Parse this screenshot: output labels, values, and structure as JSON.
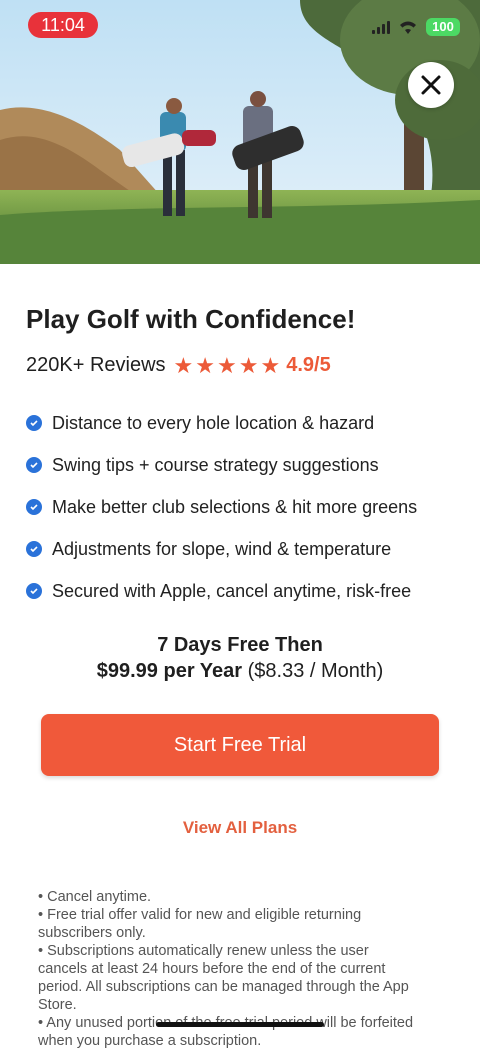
{
  "status_bar": {
    "time": "11:04",
    "battery": "100"
  },
  "headline": "Play Golf with Confidence!",
  "reviews": {
    "count": "220K+ Reviews",
    "rating": "4.9/5",
    "stars": 5
  },
  "features": [
    "Distance to every hole location & hazard",
    "Swing tips + course strategy suggestions",
    "Make better club selections & hit more greens",
    "Adjustments for slope, wind & temperature",
    "Secured with Apple, cancel anytime, risk-free"
  ],
  "pricing": {
    "line1": "7 Days Free Then",
    "price": "$99.99 per Year",
    "monthly": "($8.33 / Month)"
  },
  "cta_label": "Start Free Trial",
  "view_plans_label": "View All Plans",
  "terms": [
    "• Cancel anytime.",
    "• Free trial offer valid for new and eligible returning subscribers only.",
    "• Subscriptions automatically renew unless the user cancels at least 24 hours before the end of the current period. All subscriptions can be managed through the App Store.",
    "• Any unused portion of the free trial period will be forfeited when you purchase a subscription."
  ],
  "colors": {
    "accent": "#f0593a",
    "check": "#2a72d9",
    "status_pill": "#e8323a"
  }
}
